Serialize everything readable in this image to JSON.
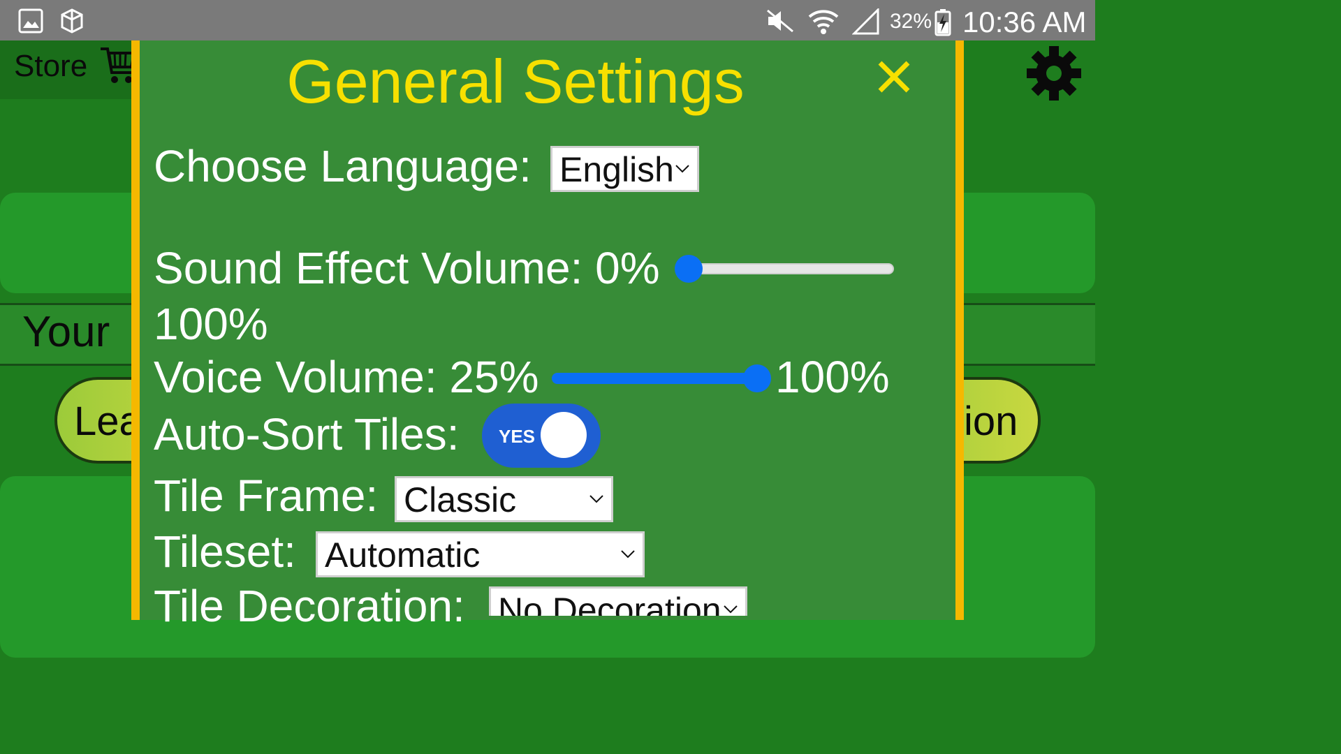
{
  "status_bar": {
    "battery": "32%",
    "time": "10:36 AM",
    "icons": [
      "gallery-icon",
      "app-icon",
      "mute-icon",
      "wifi-icon",
      "signal-icon",
      "battery-charging-icon"
    ]
  },
  "background": {
    "store_label": "Store",
    "your_label": "Your",
    "pill_left": "Lea",
    "pill_right": "ion"
  },
  "modal": {
    "title": "General Settings",
    "close_symbol": "×",
    "language": {
      "label": "Choose Language:",
      "value": "English"
    },
    "sound": {
      "label": "Sound Effect Volume: 0%",
      "max": "100%",
      "value_percent": 0
    },
    "voice": {
      "label": "Voice Volume: 25%",
      "max": "100%",
      "value_percent": 100
    },
    "autosort": {
      "label": "Auto-Sort Tiles:",
      "toggle_text": "YES",
      "on": true
    },
    "tile_frame": {
      "label": "Tile Frame:",
      "value": "Classic"
    },
    "tileset": {
      "label": "Tileset:",
      "value": "Automatic"
    },
    "decoration": {
      "label": "Tile Decoration:",
      "value": "No Decoration"
    }
  },
  "colors": {
    "accent": "#f7e000",
    "modal_bg": "#378c37",
    "border": "#f5b800",
    "slider": "#0a6ff5"
  }
}
